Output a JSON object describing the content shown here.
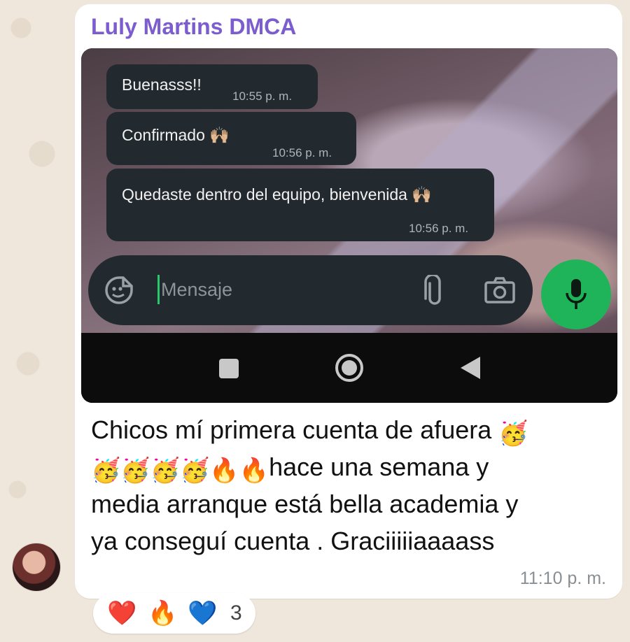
{
  "sender": {
    "name": "Luly Martins DMCA"
  },
  "screenshot": {
    "messages": [
      {
        "text": "Buenasss!!",
        "time": "10:55 p. m."
      },
      {
        "text": "Confirmado 🙌🏼",
        "time": "10:56 p. m."
      },
      {
        "text": "Quedaste dentro del equipo, bienvenida 🙌🏼",
        "time": "10:56 p. m."
      }
    ],
    "input_placeholder": "Mensaje",
    "icons": {
      "sticker": "sticker-icon",
      "attach": "paperclip-icon",
      "camera": "camera-icon",
      "mic": "microphone-icon",
      "nav_recents": "square-icon",
      "nav_home": "circle-icon",
      "nav_back": "back-triangle-icon"
    }
  },
  "message": {
    "line1": "Chicos mí primera cuenta de afuera",
    "line2_text": "hace una semana y",
    "line3": "media arranque está bella academia y",
    "line4": "ya conseguí cuenta . Graciiiiiaaaass",
    "time": "11:10 p. m.",
    "emoji_party": "🥳",
    "emoji_fire": "🔥"
  },
  "reactions": {
    "emojis": [
      "❤️",
      "🔥",
      "💙"
    ],
    "count": "3"
  },
  "colors": {
    "sender_name": "#7b5dcf",
    "mic_button": "#1fb35a",
    "caret": "#27c96a",
    "dark_bubble": "#232a2f"
  }
}
